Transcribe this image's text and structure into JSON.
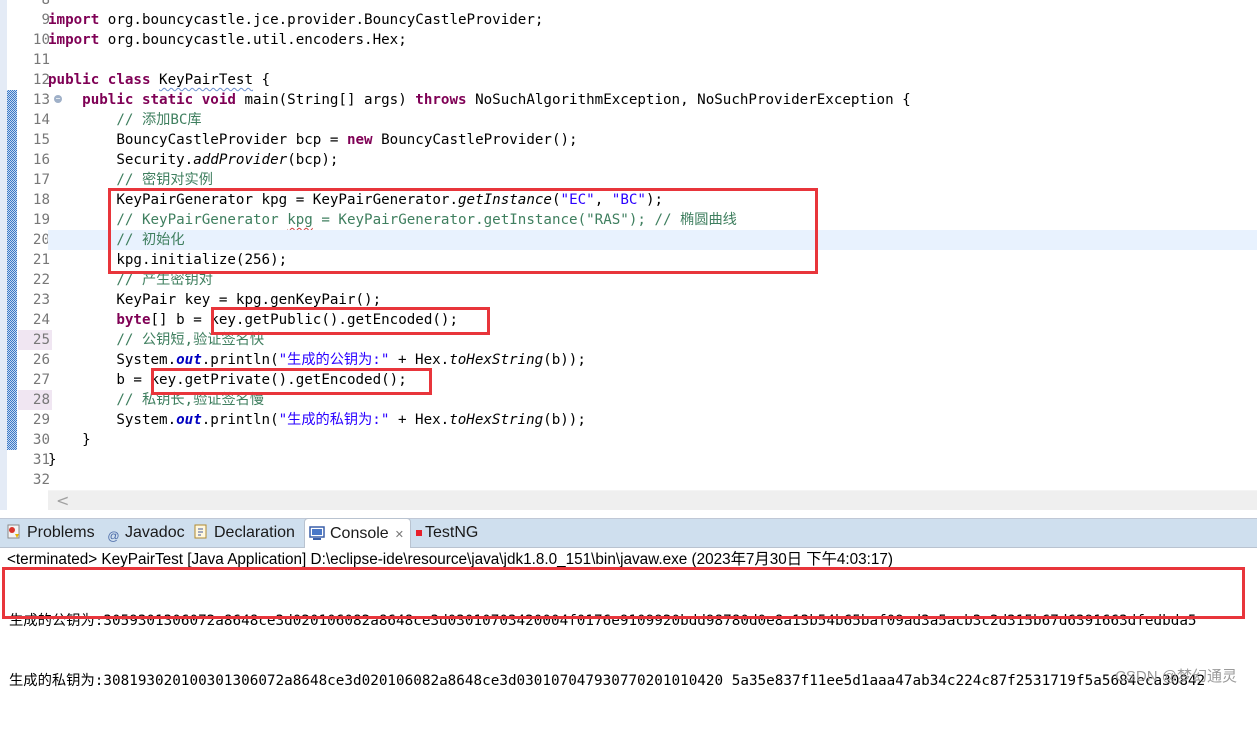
{
  "editor": {
    "line_numbers": [
      "8",
      "9",
      "10",
      "11",
      "12",
      "13",
      "14",
      "15",
      "16",
      "17",
      "18",
      "19",
      "20",
      "21",
      "22",
      "23",
      "24",
      "25",
      "26",
      "27",
      "28",
      "29",
      "30",
      "31",
      "32"
    ],
    "lines": {
      "l9": {
        "kw": "import",
        "rest": " org.bouncycastle.jce.provider.BouncyCastleProvider;"
      },
      "l10": {
        "kw": "import",
        "rest": " org.bouncycastle.util.encoders.Hex;"
      },
      "l12": {
        "kw": "public class",
        "sp": " ",
        "cls": "KeyPairTest",
        "rest": " {"
      },
      "l13": {
        "indent": "    ",
        "kw": "public static void",
        "rest": " main(String[] args) ",
        "kw2": "throws",
        "rest2": " NoSuchAlgorithmException, NoSuchProviderException {"
      },
      "l14": {
        "indent": "        ",
        "comment": "// 添加BC库"
      },
      "l15": {
        "indent": "        ",
        "pre": "BouncyCastleProvider bcp = ",
        "kw": "new",
        "rest": " BouncyCastleProvider();"
      },
      "l16": {
        "indent": "        ",
        "pre": "Security.",
        "it": "addProvider",
        "rest": "(bcp);"
      },
      "l17": {
        "indent": "        ",
        "comment": "// 密钥对实例"
      },
      "l18": {
        "indent": "        ",
        "pre": "KeyPairGenerator kpg = KeyPairGenerator.",
        "it": "getInstance",
        "p1": "(",
        "s1": "\"EC\"",
        "p2": ", ",
        "s2": "\"BC\"",
        "rest": ");"
      },
      "l19": {
        "indent": "        ",
        "c1": "// KeyPairGenerator ",
        "sq": "kpg",
        "c2": " = KeyPairGenerator.getInstance(\"RAS\"); // 椭圆曲线"
      },
      "l20": {
        "indent": "        ",
        "comment": "// 初始化"
      },
      "l21": {
        "indent": "        ",
        "code": "kpg.initialize(256);"
      },
      "l22": {
        "indent": "        ",
        "comment": "// 产生密钥对"
      },
      "l23": {
        "indent": "        ",
        "code": "KeyPair key = kpg.genKeyPair();"
      },
      "l24": {
        "indent": "        ",
        "kw": "byte",
        "rest": "[] b = key.getPublic().getEncoded();"
      },
      "l25": {
        "indent": "        ",
        "comment": "// 公钥短,验证签名快"
      },
      "l26": {
        "indent": "        ",
        "pre": "System.",
        "fld": "out",
        "mid": ".println(",
        "str": "\"生成的公钥为:\"",
        "mid2": " + Hex.",
        "it": "toHexString",
        "rest": "(b));"
      },
      "l27": {
        "indent": "        ",
        "code": "b = key.getPrivate().getEncoded();"
      },
      "l28": {
        "indent": "        ",
        "comment": "// 私钥长,验证签名慢"
      },
      "l29": {
        "indent": "        ",
        "pre": "System.",
        "fld": "out",
        "mid": ".println(",
        "str": "\"生成的私钥为:\"",
        "mid2": " + Hex.",
        "it": "toHexString",
        "rest": "(b));"
      },
      "l30": {
        "indent": "    ",
        "code": "}"
      },
      "l31": {
        "indent": "",
        "code": "}"
      }
    },
    "scroll_left": "<"
  },
  "panel": {
    "tabs": [
      {
        "label": "Problems",
        "icon": "problems-icon"
      },
      {
        "label": "Javadoc",
        "icon": "javadoc-icon",
        "glyph": "@"
      },
      {
        "label": "Declaration",
        "icon": "declaration-icon"
      },
      {
        "label": "Console",
        "icon": "console-icon",
        "active": true,
        "close": "✕"
      },
      {
        "label": "TestNG",
        "icon": "testng-icon"
      }
    ],
    "status": "<terminated> KeyPairTest [Java Application] D:\\eclipse-ide\\resource\\java\\jdk1.8.0_151\\bin\\javaw.exe (2023年7月30日 下午4:03:17)",
    "output": [
      "生成的公钥为:3059301306072a8648ce3d020106082a8648ce3d03010703420004f0176e9109920bdd98780d0e8a13b54b65baf09ad3a5acb3c2d315b67d6391663dfedbda5",
      "生成的私钥为:308193020100301306072a8648ce3d020106082a8648ce3d030107047930770201010420 5a35e837f11ee5d1aaa47ab34c224c87f2531719f5a5684eca30842"
    ]
  },
  "watermark": "CSDN @梦幻通灵",
  "colors": {
    "keyword": "#7f0055",
    "comment": "#3f7f5f",
    "string": "#2a00ff",
    "field": "#0000c0",
    "highlight_box": "#e8353b",
    "current_line": "#e8f2fe",
    "tabbar": "#cfdfee"
  }
}
